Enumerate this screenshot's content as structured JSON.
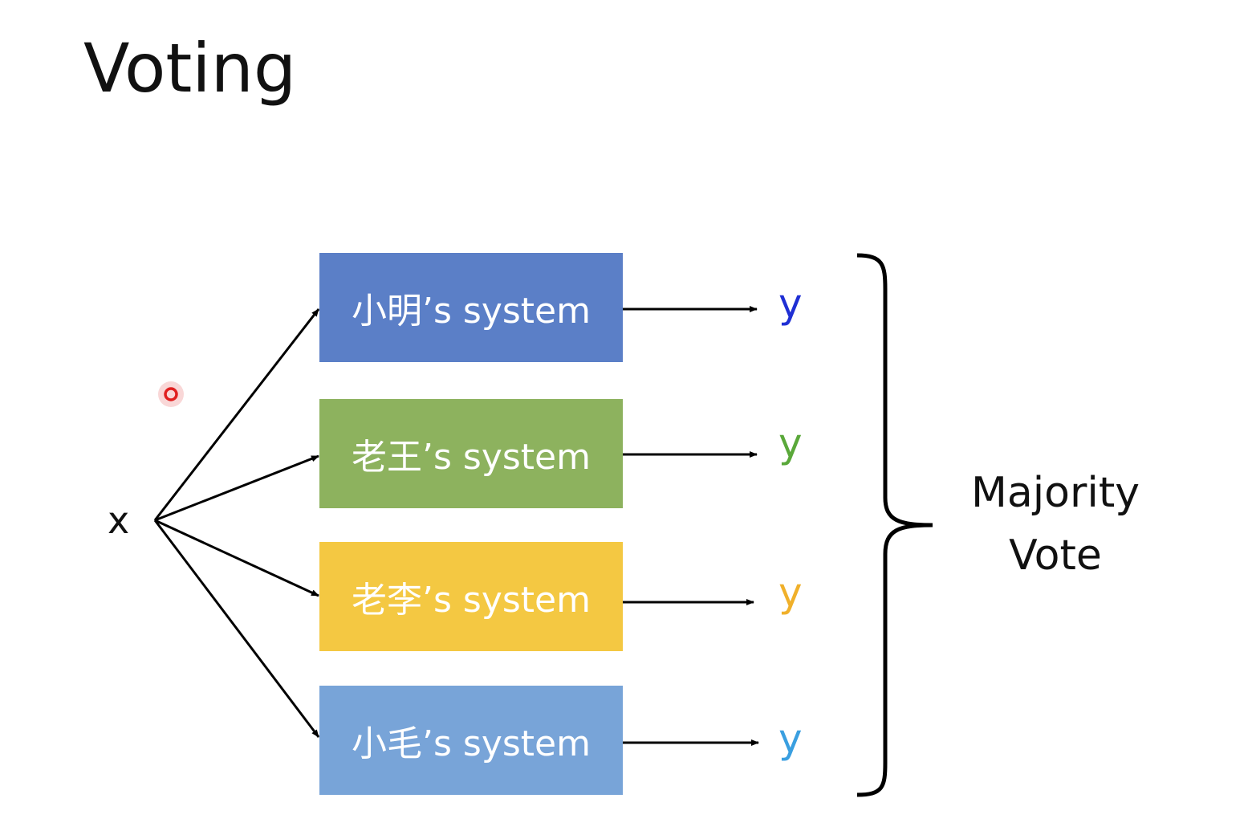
{
  "title": "Voting",
  "input": "x",
  "systems": [
    {
      "label": "小明’s system",
      "color": "#5b7fc7",
      "output": "y",
      "output_color": "#1f2fd4"
    },
    {
      "label": "老王’s system",
      "color": "#8db25e",
      "output": "y",
      "output_color": "#5aa83a"
    },
    {
      "label": "老李’s system",
      "color": "#f4c842",
      "output": "y",
      "output_color": "#f0b02a"
    },
    {
      "label": "小毛’s system",
      "color": "#78a4d8",
      "output": "y",
      "output_color": "#3a9fe0"
    }
  ],
  "majority_vote": {
    "line1": "Majority",
    "line2": "Vote"
  },
  "colors": {
    "pointer": "#e02020"
  }
}
